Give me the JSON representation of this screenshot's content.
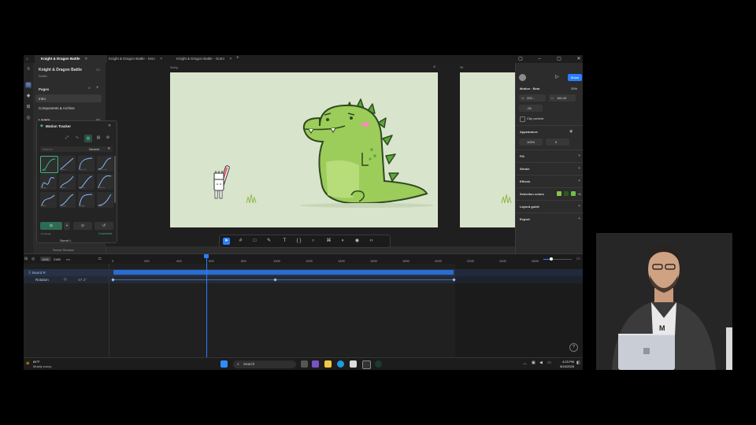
{
  "tabs": [
    {
      "label": "Knight & Dragon Battle",
      "active": true
    },
    {
      "label": "Knight & Dragon Battle - Intro",
      "active": false
    },
    {
      "label": "Knight & Dragon Battle - Outro",
      "active": false
    }
  ],
  "tab_add": "+",
  "window_controls": [
    "▢",
    "–",
    "▢",
    "✕"
  ],
  "project": {
    "name": "Knight & Dragon Battle",
    "subtitle": "Drafts",
    "pages_label": "Pages",
    "pages": [
      "Intro",
      "Components & Archive"
    ],
    "layers_label": "Layers",
    "layers_count": "88"
  },
  "canvas": {
    "frame_label": "Swing",
    "frame2_label": "Hit",
    "settings_glyph": "⚙"
  },
  "toolbar_tools": [
    "move-tool",
    "frame-tool",
    "shape-tool",
    "pen-tool",
    "text-tool",
    "component-tool",
    "comment-tool",
    "actions-tool",
    "dev-mode",
    "multiplayer",
    "code-tool"
  ],
  "tool_glyphs": [
    "➤",
    "#",
    "□",
    "✎",
    "T",
    "{ }",
    "○",
    "⌘",
    "◐",
    "◉",
    "‹›"
  ],
  "right_panel": {
    "share_label": "Share",
    "play_glyph": "▷",
    "section_title": "Motion · Beta",
    "zoom": "29%",
    "w_label": "W",
    "w_value": "202...",
    "h_label": "H",
    "h_value": "160.43",
    "rotation_value": "-53",
    "clip_content": "Clip content",
    "appearance": "Appearance",
    "opacity": "100%",
    "corner": "0",
    "fill": "Fill",
    "stroke": "Stroke",
    "effects": "Effects",
    "selection_colors": "Selection colors",
    "selection_colors_more": "+4",
    "selection_color_swatches": [
      "#8bc34a",
      "#2d5a1e",
      "#6fbf4a"
    ],
    "layout_guide": "Layout guide",
    "export": "Export"
  },
  "tracker": {
    "title": "Motion Tracker",
    "search_placeholder": "Search",
    "sort_value": "Newest",
    "sort_chevron": "▾",
    "presets": [
      "Linear",
      "Ease In",
      "Ease Out",
      "Ease In Out",
      "Spring",
      "Bounce",
      "Back In",
      "Back Out",
      "Elastic",
      "Smooth",
      "Snappy",
      "Gentle"
    ],
    "footer_left": "11 curves",
    "footer_right": "Connected",
    "layer_a": "Sword L",
    "layer_b": "Sword Shadow"
  },
  "timeline": {
    "fps_label": "1000",
    "duration": "2160",
    "unit": "ms",
    "ticks": [
      "0",
      "200",
      "400",
      "600",
      "800",
      "1000",
      "1200",
      "1400",
      "1600",
      "1800",
      "2000",
      "2200",
      "2400",
      "2600"
    ],
    "track_name": "Sword R",
    "property_name": "Rotation",
    "property_value": "-37.3°",
    "help": "?"
  },
  "taskbar": {
    "weather_temp": "84°F",
    "weather_desc": "Mostly sunny",
    "search_label": "Search",
    "time": "4:23 PM",
    "date": "6/24/2026"
  },
  "colors": {
    "accent": "#2a7fff",
    "frame_bg": "#d9e4cc",
    "dragon": "#9ccc5a",
    "tracker_accent": "#3fb884"
  }
}
